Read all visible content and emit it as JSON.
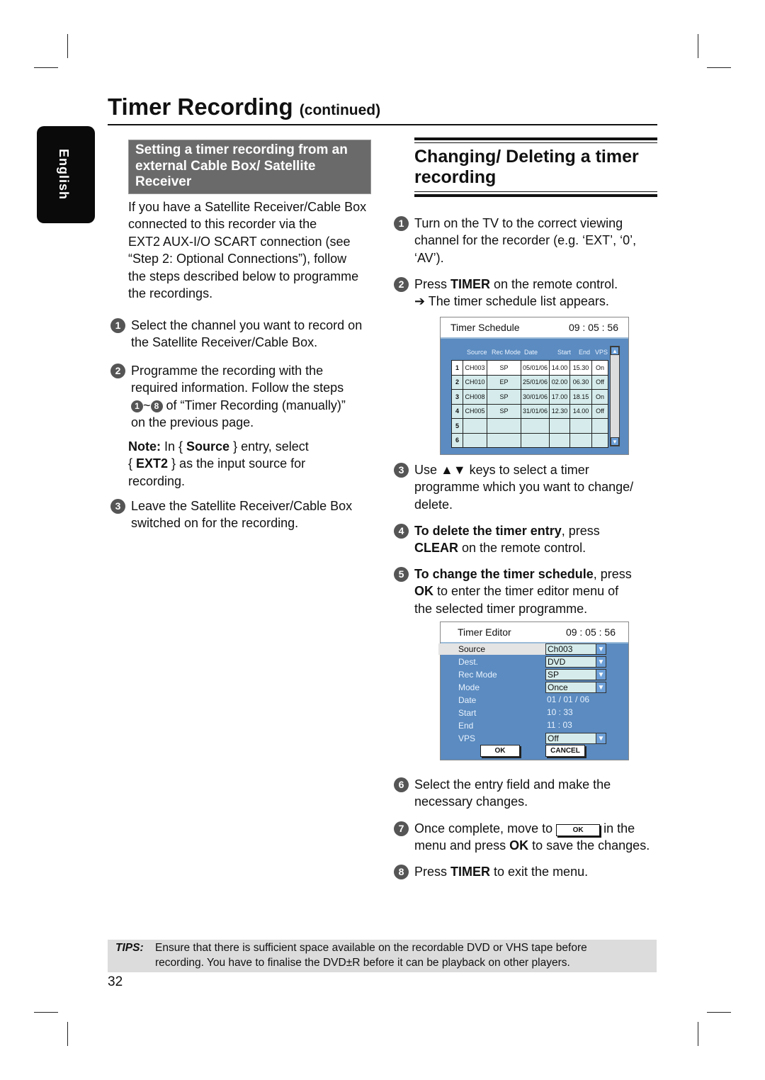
{
  "title": {
    "main": "Timer Recording",
    "sub": "(continued)"
  },
  "language_tab": "English",
  "left": {
    "box_heading": "Setting a timer recording from an external Cable Box/ Satellite Receiver",
    "intro": [
      [
        {
          "t": "If you have a Satellite Receiver/Cable Box"
        }
      ],
      [
        {
          "t": "connected to this recorder via the"
        }
      ],
      [
        {
          "t": "EXT2 AUX-I/O SCART connection (see"
        }
      ],
      [
        {
          "t": "“Step 2: Optional Connections”), follow"
        }
      ],
      [
        {
          "t": "the steps described below to programme"
        }
      ],
      [
        {
          "t": "the recordings."
        }
      ]
    ],
    "steps": [
      {
        "n": "1",
        "lines": [
          [
            {
              "t": "Select the channel you want to record on"
            }
          ],
          [
            {
              "t": "the Satellite Receiver/Cable Box."
            }
          ]
        ]
      },
      {
        "n": "2",
        "lines": [
          [
            {
              "t": "Programme the recording with the"
            }
          ],
          [
            {
              "t": "required information. Follow the steps"
            }
          ],
          [
            {
              "i": "1"
            },
            {
              "t": "~"
            },
            {
              "i": "8"
            },
            {
              "t": " of “Timer Recording (manually)”"
            }
          ],
          [
            {
              "t": "on the previous page."
            }
          ]
        ]
      },
      {
        "n": "3",
        "lines": [
          [
            {
              "t": "Leave the Satellite Receiver/Cable Box"
            }
          ],
          [
            {
              "t": "switched on for the recording."
            }
          ]
        ]
      }
    ],
    "note": [
      [
        {
          "t": "Note:",
          "b": 1
        },
        {
          "t": "  In { "
        },
        {
          "t": "Source",
          "b": 1
        },
        {
          "t": " } entry, select"
        }
      ],
      [
        {
          "t": "{ "
        },
        {
          "t": "EXT2",
          "b": 1
        },
        {
          "t": " } as the input source for"
        }
      ],
      [
        {
          "t": "recording."
        }
      ]
    ]
  },
  "right": {
    "heading": "Changing/ Deleting a timer recording",
    "steps": [
      {
        "n": "1",
        "lines": [
          [
            {
              "t": "Turn on the TV to the correct viewing"
            }
          ],
          [
            {
              "t": "channel for the recorder (e.g. ‘EXT’, ‘0’,"
            }
          ],
          [
            {
              "t": "‘AV’)."
            }
          ]
        ]
      },
      {
        "n": "2",
        "lines": [
          [
            {
              "t": "Press "
            },
            {
              "t": "TIMER",
              "b": 1
            },
            {
              "t": " on the remote control."
            }
          ],
          [
            {
              "t": "➔ The timer schedule list appears."
            }
          ]
        ]
      },
      {
        "n": "3",
        "lines": [
          [
            {
              "t": "Use ▲▼ keys to select a timer"
            }
          ],
          [
            {
              "t": "programme which you want to change/"
            }
          ],
          [
            {
              "t": "delete."
            }
          ]
        ]
      },
      {
        "n": "4",
        "lines": [
          [
            {
              "t": "To delete the timer entry",
              "b": 1
            },
            {
              "t": ", press"
            }
          ],
          [
            {
              "t": "CLEAR",
              "b": 1
            },
            {
              "t": " on the remote control."
            }
          ]
        ]
      },
      {
        "n": "5",
        "lines": [
          [
            {
              "t": "To change the timer schedule",
              "b": 1
            },
            {
              "t": ", press"
            }
          ],
          [
            {
              "t": "OK",
              "b": 1
            },
            {
              "t": " to enter the timer editor menu of"
            }
          ],
          [
            {
              "t": "the selected timer programme."
            }
          ]
        ]
      },
      {
        "n": "6",
        "lines": [
          [
            {
              "t": "Select the entry field and make the"
            }
          ],
          [
            {
              "t": "necessary changes."
            }
          ]
        ]
      },
      {
        "n": "7",
        "lines": [
          [
            {
              "t": "Once complete, move to "
            },
            {
              "ok": "OK"
            },
            {
              "t": " in the"
            }
          ],
          [
            {
              "t": "menu and press "
            },
            {
              "t": "OK",
              "b": 1
            },
            {
              "t": " to save the changes."
            }
          ]
        ]
      },
      {
        "n": "8",
        "lines": [
          [
            {
              "t": "Press "
            },
            {
              "t": "TIMER",
              "b": 1
            },
            {
              "t": " to exit the menu."
            }
          ]
        ]
      }
    ]
  },
  "timer_schedule": {
    "title": "Timer Schedule",
    "clock": "09 : 05 : 56",
    "columns": [
      "Source",
      "Rec Mode",
      "Date",
      "Start",
      "End",
      "VPS"
    ],
    "rows": [
      [
        "1",
        "CH003",
        "SP",
        "05/01/06",
        "14.00",
        "15.30",
        "On"
      ],
      [
        "2",
        "CH010",
        "EP",
        "25/01/06",
        "02.00",
        "06.30",
        "Off"
      ],
      [
        "3",
        "CH008",
        "SP",
        "30/01/06",
        "17.00",
        "18.15",
        "On"
      ],
      [
        "4",
        "CH005",
        "SP",
        "31/01/06",
        "12.30",
        "14.00",
        "Off"
      ],
      [
        "5",
        "",
        "",
        "",
        "",
        "",
        ""
      ],
      [
        "6",
        "",
        "",
        "",
        "",
        "",
        ""
      ]
    ],
    "selected_row": 1
  },
  "timer_editor": {
    "title": "Timer Editor",
    "clock": "09 : 05 : 56",
    "fields": [
      {
        "label": "Source",
        "value": "Ch003",
        "dropdown": true
      },
      {
        "label": "Dest.",
        "value": "DVD",
        "dropdown": true
      },
      {
        "label": "Rec Mode",
        "value": "SP",
        "dropdown": true
      },
      {
        "label": "Mode",
        "value": "Once",
        "dropdown": true
      },
      {
        "label": "Date",
        "value": "01 / 01 / 06",
        "dropdown": false
      },
      {
        "label": "Start",
        "value": "10 : 33",
        "dropdown": false
      },
      {
        "label": "End",
        "value": "11 : 03",
        "dropdown": false
      },
      {
        "label": "VPS",
        "value": "Off",
        "dropdown": true
      }
    ],
    "ok": "OK",
    "cancel": "CANCEL"
  },
  "tips": {
    "label": "TIPS:",
    "lines": [
      "Ensure that there is sufficient space available on the recordable DVD or VHS tape before",
      "recording. You have to finalise the DVD±R before it can be playback on other players."
    ]
  },
  "page_number": "32"
}
